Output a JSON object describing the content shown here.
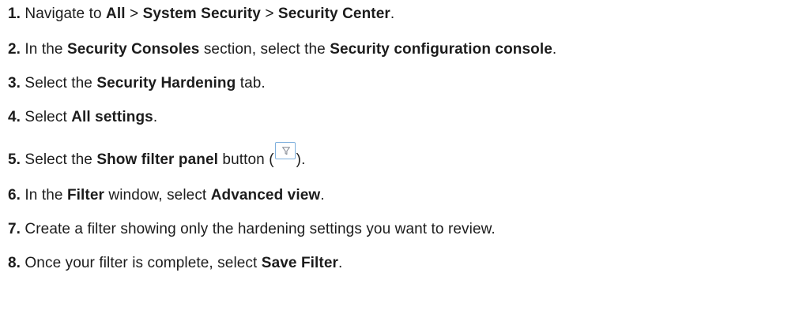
{
  "steps": [
    {
      "num": "1.",
      "t1": " Navigate to ",
      "b1": "All",
      "t2": " > ",
      "b2": "System Security",
      "t3": " > ",
      "b3": "Security Center",
      "t4": "."
    },
    {
      "num": "2.",
      "t1": " In the ",
      "b1": "Security Consoles",
      "t2": " section, select the ",
      "b2": "Security configuration console",
      "t3": "."
    },
    {
      "num": "3.",
      "t1": " Select the ",
      "b1": "Security Hardening",
      "t2": " tab."
    },
    {
      "num": "4.",
      "t1": " Select ",
      "b1": "All settings",
      "t2": "."
    },
    {
      "num": "5.",
      "t1": " Select the ",
      "b1": "Show filter panel",
      "t2": " button (",
      "icon": "filter-funnel-icon",
      "t3": ")."
    },
    {
      "num": "6.",
      "t1": " In the ",
      "b1": "Filter",
      "t2": " window, select ",
      "b2": "Advanced view",
      "t3": "."
    },
    {
      "num": "7.",
      "t1": " Create a filter showing only the hardening settings you want to review."
    },
    {
      "num": "8.",
      "t1": " Once your filter is complete, select ",
      "b1": "Save Filter",
      "t2": "."
    }
  ],
  "colors": {
    "text": "#1c1c1c",
    "filter_icon_border": "#7fb0dd",
    "filter_icon_stroke": "#8a8f98"
  }
}
